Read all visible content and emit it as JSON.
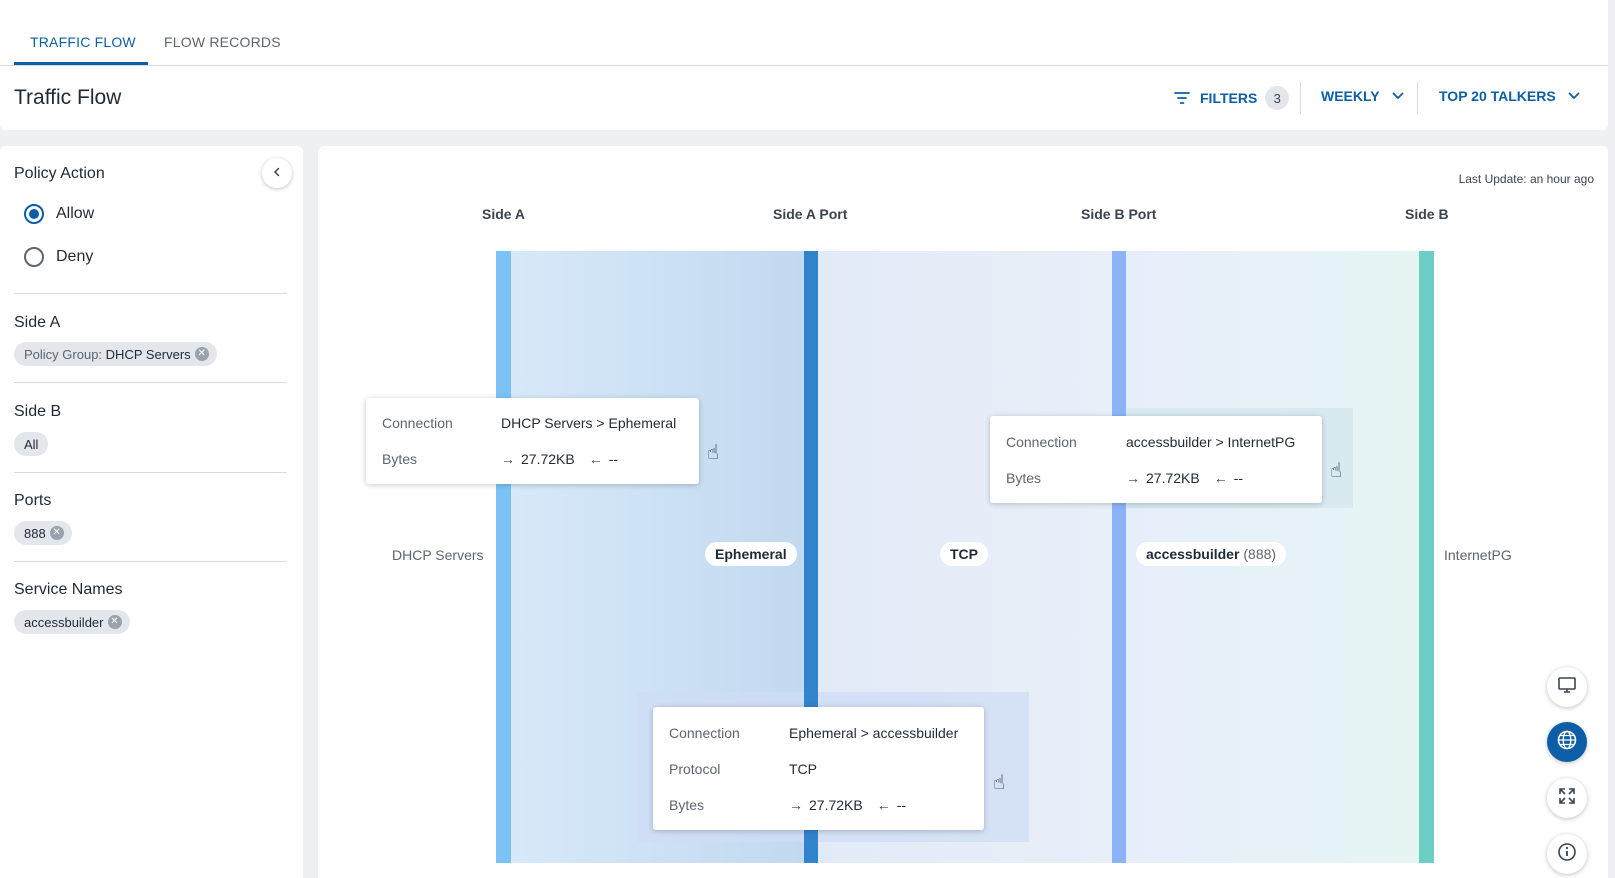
{
  "tabs": [
    {
      "label": "TRAFFIC FLOW",
      "active": true
    },
    {
      "label": "FLOW RECORDS",
      "active": false
    }
  ],
  "page_title": "Traffic Flow",
  "controls": {
    "filters_label": "FILTERS",
    "filters_count": "3",
    "period_label": "WEEKLY",
    "talkers_label": "TOP 20 TALKERS"
  },
  "sidebar": {
    "policy_action": {
      "title": "Policy Action",
      "options": [
        {
          "label": "Allow",
          "selected": true
        },
        {
          "label": "Deny",
          "selected": false
        }
      ]
    },
    "side_a": {
      "title": "Side A",
      "chip_prefix": "Policy Group:",
      "chip_value": "DHCP Servers"
    },
    "side_b": {
      "title": "Side B",
      "chip_value": "All"
    },
    "ports": {
      "title": "Ports",
      "chip_value": "888"
    },
    "service_names": {
      "title": "Service Names",
      "chip_value": "accessbuilder"
    }
  },
  "flow": {
    "last_update": "Last Update: an hour ago",
    "columns": [
      "Side A",
      "Side A Port",
      "Side B Port",
      "Side B"
    ],
    "nodes": {
      "side_a": "DHCP Servers",
      "side_a_port": "Ephemeral",
      "protocol": "TCP",
      "side_b_port": "accessbuilder",
      "side_b_port_number": "(888)",
      "side_b": "InternetPG"
    },
    "colors": {
      "side_a_bar": "#7dc2f7",
      "side_a_port_bar": "#3183cc",
      "side_b_port_bar": "#8cb2f7",
      "side_b_bar": "#6ccfc6"
    },
    "tooltips": [
      {
        "k1": "Connection",
        "v1": "DHCP Servers > Ephemeral",
        "k2": "Bytes",
        "out": "27.72KB",
        "in": "--"
      },
      {
        "k1": "Connection",
        "v1": "accessbuilder > InternetPG",
        "k2": "Bytes",
        "out": "27.72KB",
        "in": "--"
      },
      {
        "k1": "Connection",
        "v1": "Ephemeral > accessbuilder",
        "k2": "Protocol",
        "v2": "TCP",
        "k3": "Bytes",
        "out": "27.72KB",
        "in": "--"
      }
    ]
  },
  "fabs": [
    "monitor-icon",
    "globe-icon",
    "expand-icon",
    "info-icon"
  ]
}
